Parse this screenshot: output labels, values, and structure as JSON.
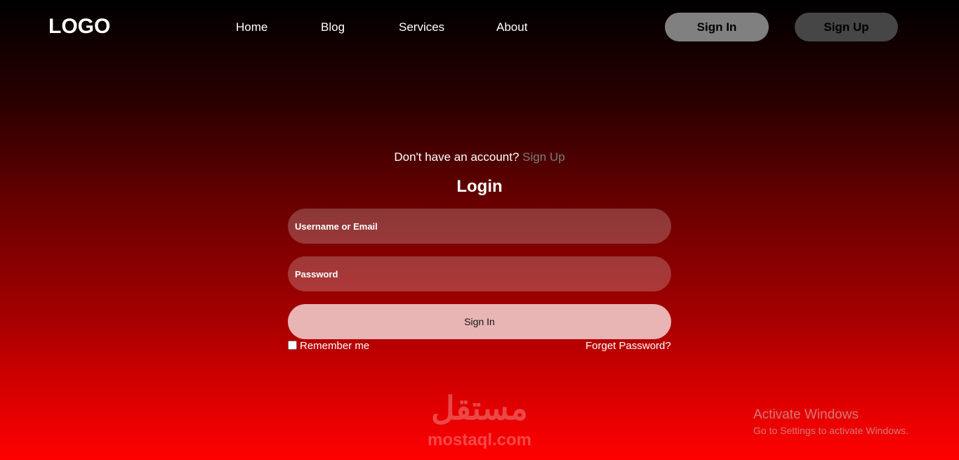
{
  "nav": {
    "logo": "LOGO",
    "links": [
      "Home",
      "Blog",
      "Services",
      "About"
    ],
    "sign_in": "Sign In",
    "sign_up": "Sign Up"
  },
  "login": {
    "hint_text": "Don't have an account?",
    "hint_link": "Sign Up",
    "title": "Login",
    "username_placeholder": "Username or Email",
    "password_placeholder": "Password",
    "submit_label": "Sign In",
    "remember_label": "Remember me",
    "forgot_label": "Forget Password?"
  },
  "watermark": {
    "arabic": "مستقل",
    "latin": "mostaql.com"
  },
  "windows_notice": {
    "title": "Activate Windows",
    "subtitle": "Go to Settings to activate Windows."
  },
  "colors": {
    "gradient_top": "#000000",
    "gradient_bottom": "#ff0000",
    "nav_sign_in_bg": "#808080",
    "nav_sign_up_bg": "#464646",
    "submit_bg": "#e8b4b4",
    "hint_link": "#7d7d7d"
  }
}
